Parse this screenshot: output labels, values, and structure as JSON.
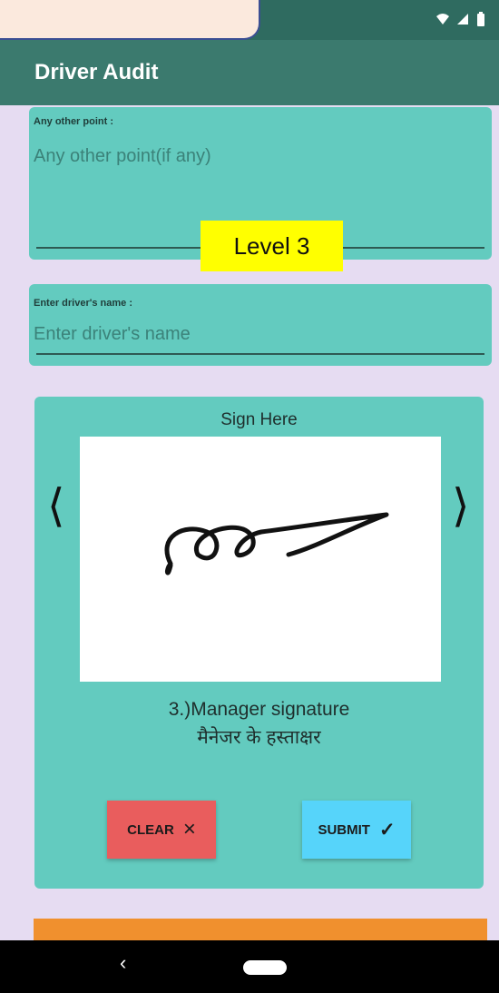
{
  "app": {
    "title": "Driver Audit"
  },
  "overlay": {
    "level_badge": "Level 3"
  },
  "fields": {
    "other_point": {
      "label": "Any other point :",
      "placeholder": "Any other point(if any)"
    },
    "driver_name": {
      "label": "Enter driver's name :",
      "placeholder": "Enter driver's name"
    }
  },
  "signature": {
    "title": "Sign Here",
    "caption_en": "3.)Manager signature",
    "caption_hi": "मैनेजर के हस्ताक्षर",
    "prev_label": "⟨",
    "next_label": "⟩"
  },
  "buttons": {
    "clear": {
      "label": "CLEAR",
      "icon": "×"
    },
    "submit": {
      "label": "SUBMIT",
      "icon": "✓"
    }
  },
  "nav": {
    "back_icon": "‹"
  },
  "colors": {
    "card": "#63cbbf",
    "clear_button": "#e95d5d",
    "submit_button": "#56d4fa",
    "badge": "#ffff00"
  }
}
